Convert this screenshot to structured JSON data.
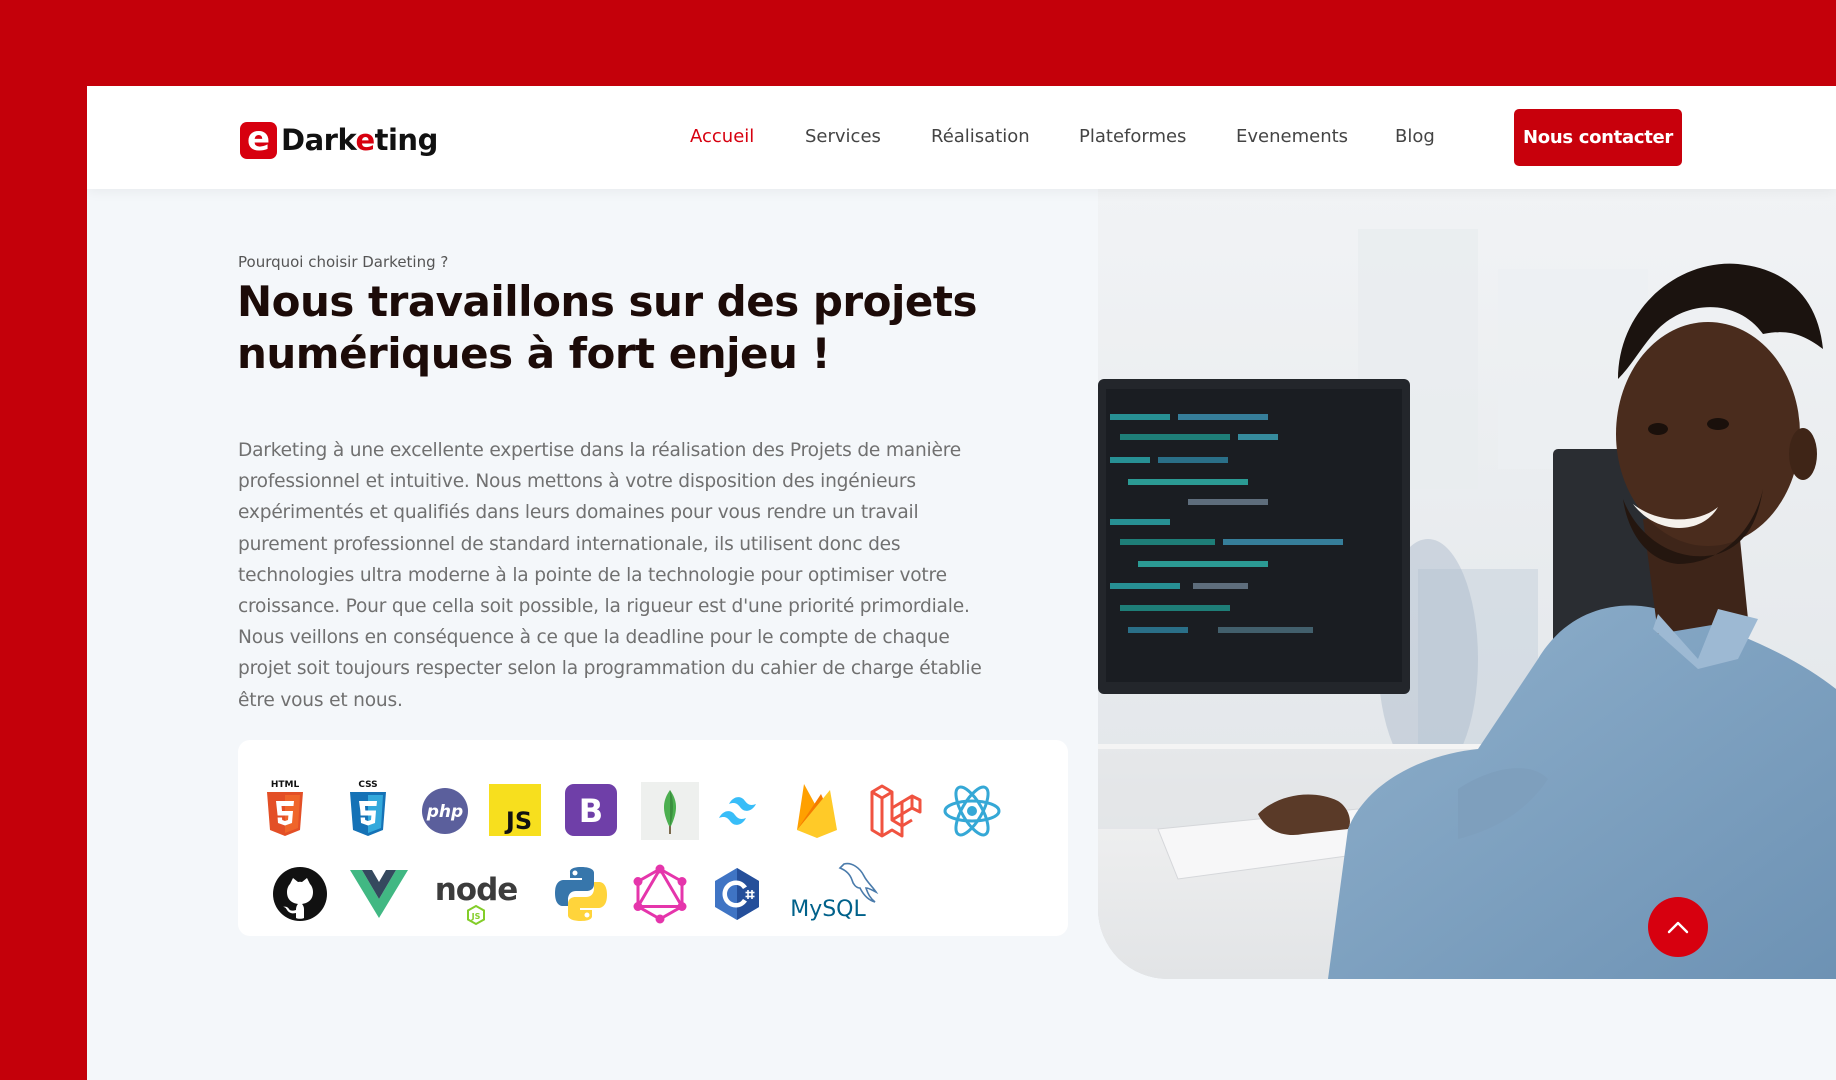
{
  "brand": {
    "logo_letter": "e",
    "logo_text_start": "Dark",
    "logo_text_highlight": "e",
    "logo_text_end": "ting"
  },
  "nav": {
    "items": [
      {
        "label": "Accueil",
        "active": true
      },
      {
        "label": "Services",
        "active": false
      },
      {
        "label": "Réalisation",
        "active": false
      },
      {
        "label": "Plateformes",
        "active": false
      },
      {
        "label": "Evenements",
        "active": false
      },
      {
        "label": "Blog",
        "active": false
      }
    ],
    "cta_label": "Nous contacter"
  },
  "hero": {
    "eyebrow": "Pourquoi choisir Darketing ?",
    "title": "Nous travaillons sur des projets numériques à fort enjeu !",
    "body": "Darketing à une excellente expertise dans la réalisation des Projets de manière professionnel et intuitive. Nous mettons à votre disposition des ingénieurs expérimentés et qualifiés dans leurs domaines pour vous rendre un travail purement professionnel de standard internationale, ils utilisent donc des technologies ultra moderne à la pointe de la technologie pour optimiser votre croissance. Pour que cella soit possible, la rigueur est d'une priorité primordiale. Nous veillons en conséquence à ce que la deadline pour le compte de chaque projet soit toujours respecter selon la programmation du cahier de charge établie être vous et nous."
  },
  "tech": {
    "html_label": "HTML",
    "css_label": "CSS",
    "php_label": "php",
    "js_label": "JS",
    "bootstrap_label": "B",
    "node_label": "node",
    "node_sub_label": "JS",
    "mysql_label": "MySQL",
    "icons": [
      "html5-icon",
      "css3-icon",
      "php-icon",
      "javascript-icon",
      "bootstrap-icon",
      "mongodb-icon",
      "tailwind-icon",
      "firebase-icon",
      "laravel-icon",
      "react-icon",
      "github-icon",
      "vue-icon",
      "nodejs-icon",
      "python-icon",
      "graphql-icon",
      "c-sharp-icon",
      "mysql-icon"
    ]
  },
  "colors": {
    "brand_red": "#c4000a",
    "title_color": "#1c0b08",
    "page_bg": "#f4f7fa"
  }
}
